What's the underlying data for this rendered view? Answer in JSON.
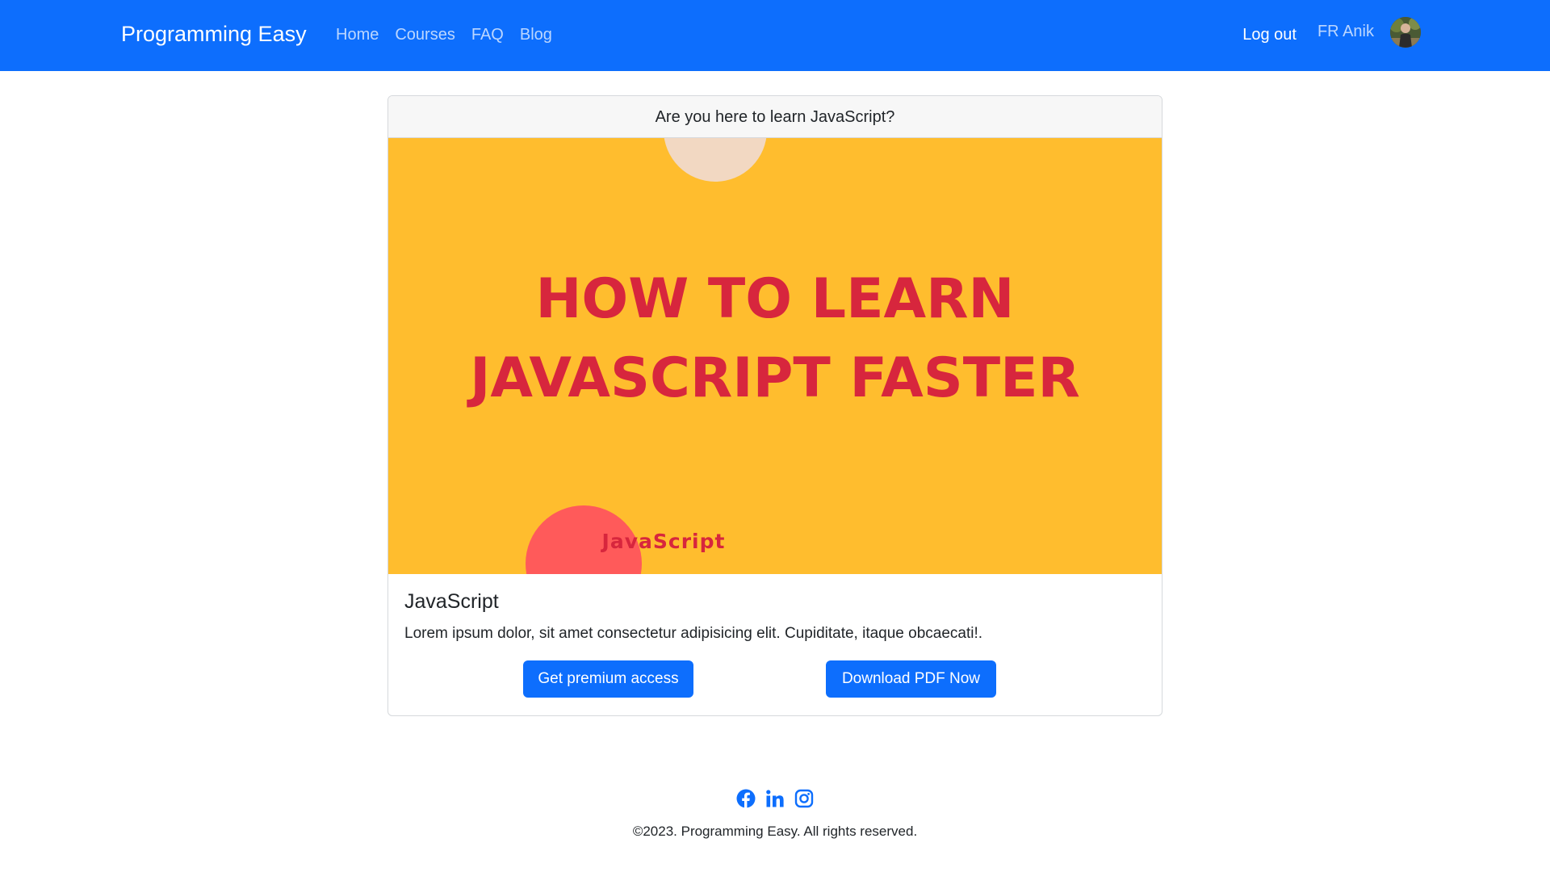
{
  "navbar": {
    "brand": "Programming Easy",
    "links": [
      "Home",
      "Courses",
      "FAQ",
      "Blog"
    ],
    "logout_label": "Log out",
    "user_name": "FR Anik",
    "accent_color": "#0d6efd"
  },
  "card": {
    "header": "Are you here to learn JavaScript?",
    "banner": {
      "headline_line1": "HOW TO LEARN",
      "headline_line2": "JAVASCRIPT FASTER",
      "tag": "JavaScript",
      "background_color": "#ffbd2e",
      "text_color": "#d7263d"
    },
    "title": "JavaScript",
    "text": "Lorem ipsum dolor, sit amet consectetur adipisicing elit. Cupiditate, itaque obcaecati!.",
    "buttons": {
      "premium": "Get premium access",
      "download": "Download PDF Now"
    }
  },
  "footer": {
    "social_icons": [
      "facebook-icon",
      "linkedin-icon",
      "instagram-icon"
    ],
    "copyright": "©2023. Programming Easy. All rights reserved."
  }
}
